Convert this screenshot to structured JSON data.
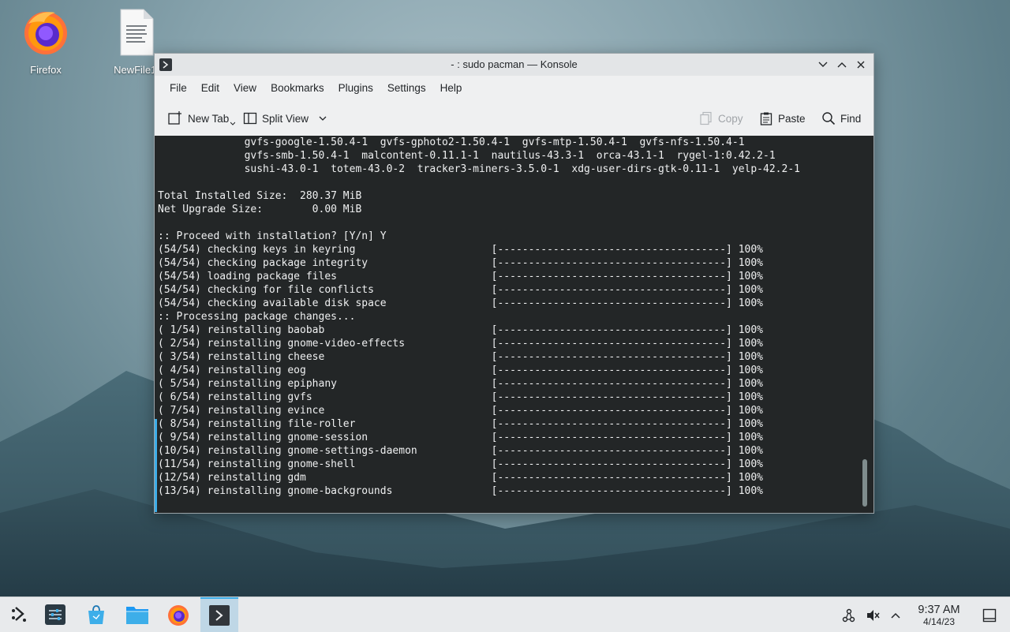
{
  "desktop": {
    "icons": [
      {
        "label": "Firefox",
        "icon": "firefox-icon"
      },
      {
        "label": "NewFile1.",
        "icon": "text-file-icon"
      }
    ]
  },
  "window": {
    "title": "- : sudo pacman — Konsole",
    "menu": [
      "File",
      "Edit",
      "View",
      "Bookmarks",
      "Plugins",
      "Settings",
      "Help"
    ],
    "toolbar": {
      "new_tab": "New Tab",
      "split_view": "Split View",
      "copy": "Copy",
      "paste": "Paste",
      "find": "Find"
    }
  },
  "terminal": {
    "lines": [
      "              gvfs-google-1.50.4-1  gvfs-gphoto2-1.50.4-1  gvfs-mtp-1.50.4-1  gvfs-nfs-1.50.4-1",
      "              gvfs-smb-1.50.4-1  malcontent-0.11.1-1  nautilus-43.3-1  orca-43.1-1  rygel-1:0.42.2-1",
      "              sushi-43.0-1  totem-43.0-2  tracker3-miners-3.5.0-1  xdg-user-dirs-gtk-0.11-1  yelp-42.2-1",
      "",
      "Total Installed Size:  280.37 MiB",
      "Net Upgrade Size:        0.00 MiB",
      "",
      ":: Proceed with installation? [Y/n] Y",
      "(54/54) checking keys in keyring                      [-------------------------------------] 100%",
      "(54/54) checking package integrity                    [-------------------------------------] 100%",
      "(54/54) loading package files                         [-------------------------------------] 100%",
      "(54/54) checking for file conflicts                   [-------------------------------------] 100%",
      "(54/54) checking available disk space                 [-------------------------------------] 100%",
      ":: Processing package changes...",
      "( 1/54) reinstalling baobab                           [-------------------------------------] 100%",
      "( 2/54) reinstalling gnome-video-effects              [-------------------------------------] 100%",
      "( 3/54) reinstalling cheese                           [-------------------------------------] 100%",
      "( 4/54) reinstalling eog                              [-------------------------------------] 100%",
      "( 5/54) reinstalling epiphany                         [-------------------------------------] 100%",
      "( 6/54) reinstalling gvfs                             [-------------------------------------] 100%",
      "( 7/54) reinstalling evince                           [-------------------------------------] 100%",
      "( 8/54) reinstalling file-roller                      [-------------------------------------] 100%",
      "( 9/54) reinstalling gnome-session                    [-------------------------------------] 100%",
      "(10/54) reinstalling gnome-settings-daemon            [-------------------------------------] 100%",
      "(11/54) reinstalling gnome-shell                      [-------------------------------------] 100%",
      "(12/54) reinstalling gdm                              [-------------------------------------] 100%",
      "(13/54) reinstalling gnome-backgrounds                [-------------------------------------] 100%"
    ]
  },
  "taskbar": {
    "clock_time": "9:37 AM",
    "clock_date": "4/14/23"
  },
  "colors": {
    "terminal_bg": "#232627",
    "terminal_fg": "#eff0f1",
    "accent": "#3daee9"
  }
}
